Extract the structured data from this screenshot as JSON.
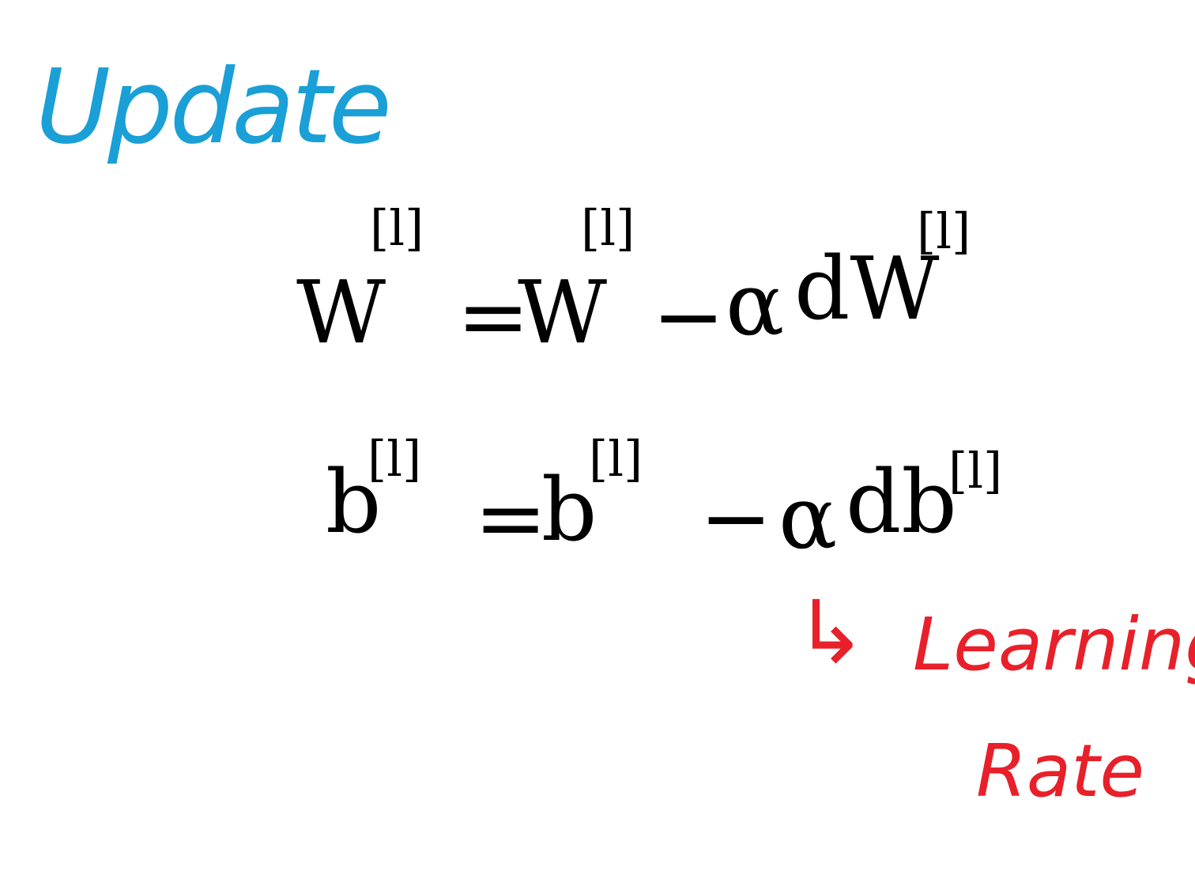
{
  "colors": {
    "title": "#1a9fd6",
    "equations": "#000000",
    "annotation": "#e8202a"
  },
  "title": "Update",
  "equations": [
    {
      "lhs": "W",
      "lhs_sup": "[l]",
      "equals": "=",
      "rhs_term": "W",
      "rhs_sup": "[l]",
      "minus": "−",
      "alpha": "α",
      "grad": "dW",
      "grad_sup": "[l]"
    },
    {
      "lhs": "b",
      "lhs_sup": "[l]",
      "equals": "=",
      "rhs_term": "b",
      "rhs_sup": "[l]",
      "minus": "−",
      "alpha": "α",
      "grad": "db",
      "grad_sup": "[l]"
    }
  ],
  "annotation": {
    "arrow": "↳",
    "line1": "Learning",
    "line2": "Rate"
  }
}
